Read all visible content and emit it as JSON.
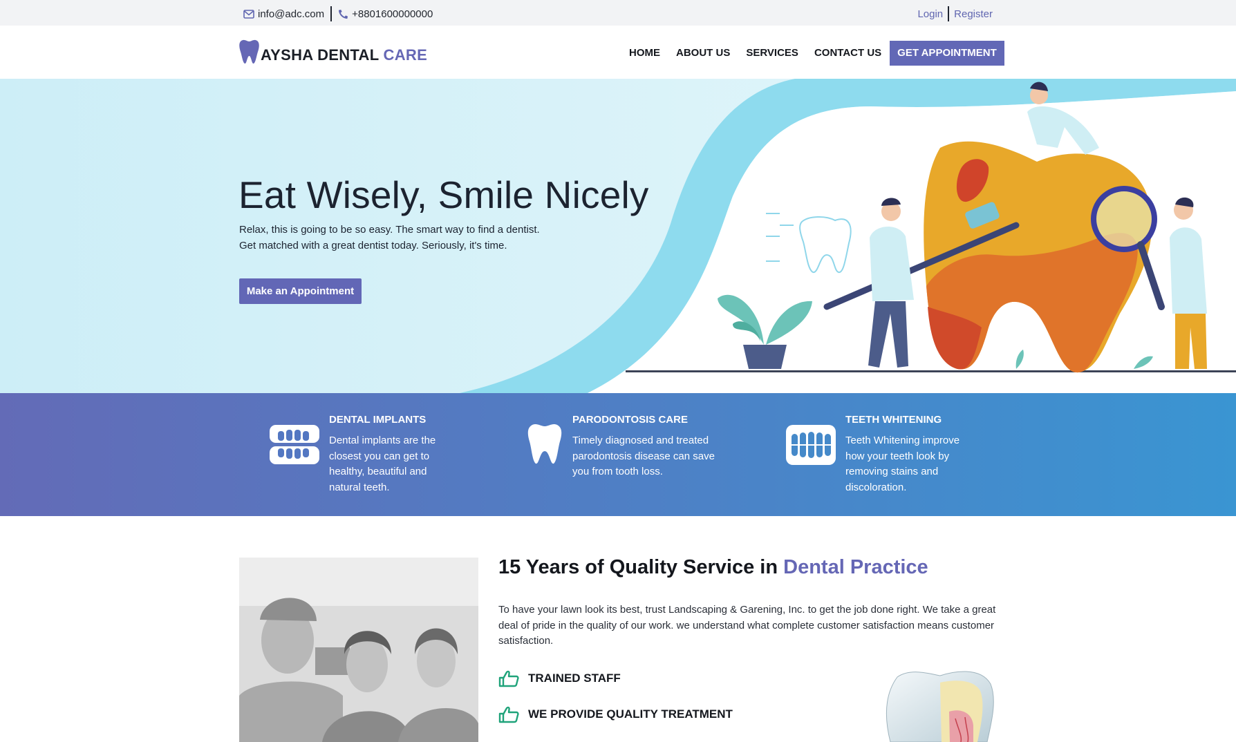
{
  "topbar": {
    "email": "info@adc.com",
    "phone": "+8801600000000",
    "login": "Login",
    "register": "Register",
    "icons": {
      "email": "envelope-icon",
      "phone": "phone-icon"
    }
  },
  "header": {
    "logo_main": "AYSHA DENTAL",
    "logo_accent": "CARE",
    "nav": [
      "HOME",
      "ABOUT US",
      "SERVICES",
      "CONTACT US"
    ],
    "cta": "GET APPOINTMENT"
  },
  "hero": {
    "title": "Eat Wisely, Smile Nicely",
    "subtitle_line1": "Relax, this is going to be so easy. The smart way to find a dentist.",
    "subtitle_line2": "Get matched with a great dentist today. Seriously, it's time.",
    "button": "Make an Appointment"
  },
  "features": [
    {
      "icon": "dentures-icon",
      "title": "DENTAL IMPLANTS",
      "desc": [
        "Dental implants are the",
        "closest you can get to",
        "healthy, beautiful and",
        "natural teeth."
      ]
    },
    {
      "icon": "tooth-icon",
      "title": "PARODONTOSIS CARE",
      "desc": [
        "Timely diagnosed and treated",
        "parodontosis disease can save",
        "you from tooth loss."
      ]
    },
    {
      "icon": "teeth-icon",
      "title": "TEETH WHITENING",
      "desc": [
        "Teeth Whitening improve",
        "how your teeth look by",
        "removing stains and",
        "discoloration."
      ]
    }
  ],
  "about": {
    "heading_main": "15 Years of Quality Service in",
    "heading_accent": "Dental Practice",
    "paragraph": "To have your lawn look its best, trust Landscaping & Garening, Inc. to get the job done right. We take a great deal of pride in the quality of our work. we understand what complete customer satisfaction means customer satisfaction.",
    "points": [
      "TRAINED STAFF",
      "WE PROVIDE QUALITY TREATMENT"
    ],
    "point_icon": "thumbs-up-icon"
  },
  "colors": {
    "brand": "#6567b5",
    "hero_bg": "#daf3f9",
    "wave": "#8edbee",
    "band_start": "#636bb7",
    "band_end": "#3a95d2",
    "check": "#1fa37a"
  }
}
